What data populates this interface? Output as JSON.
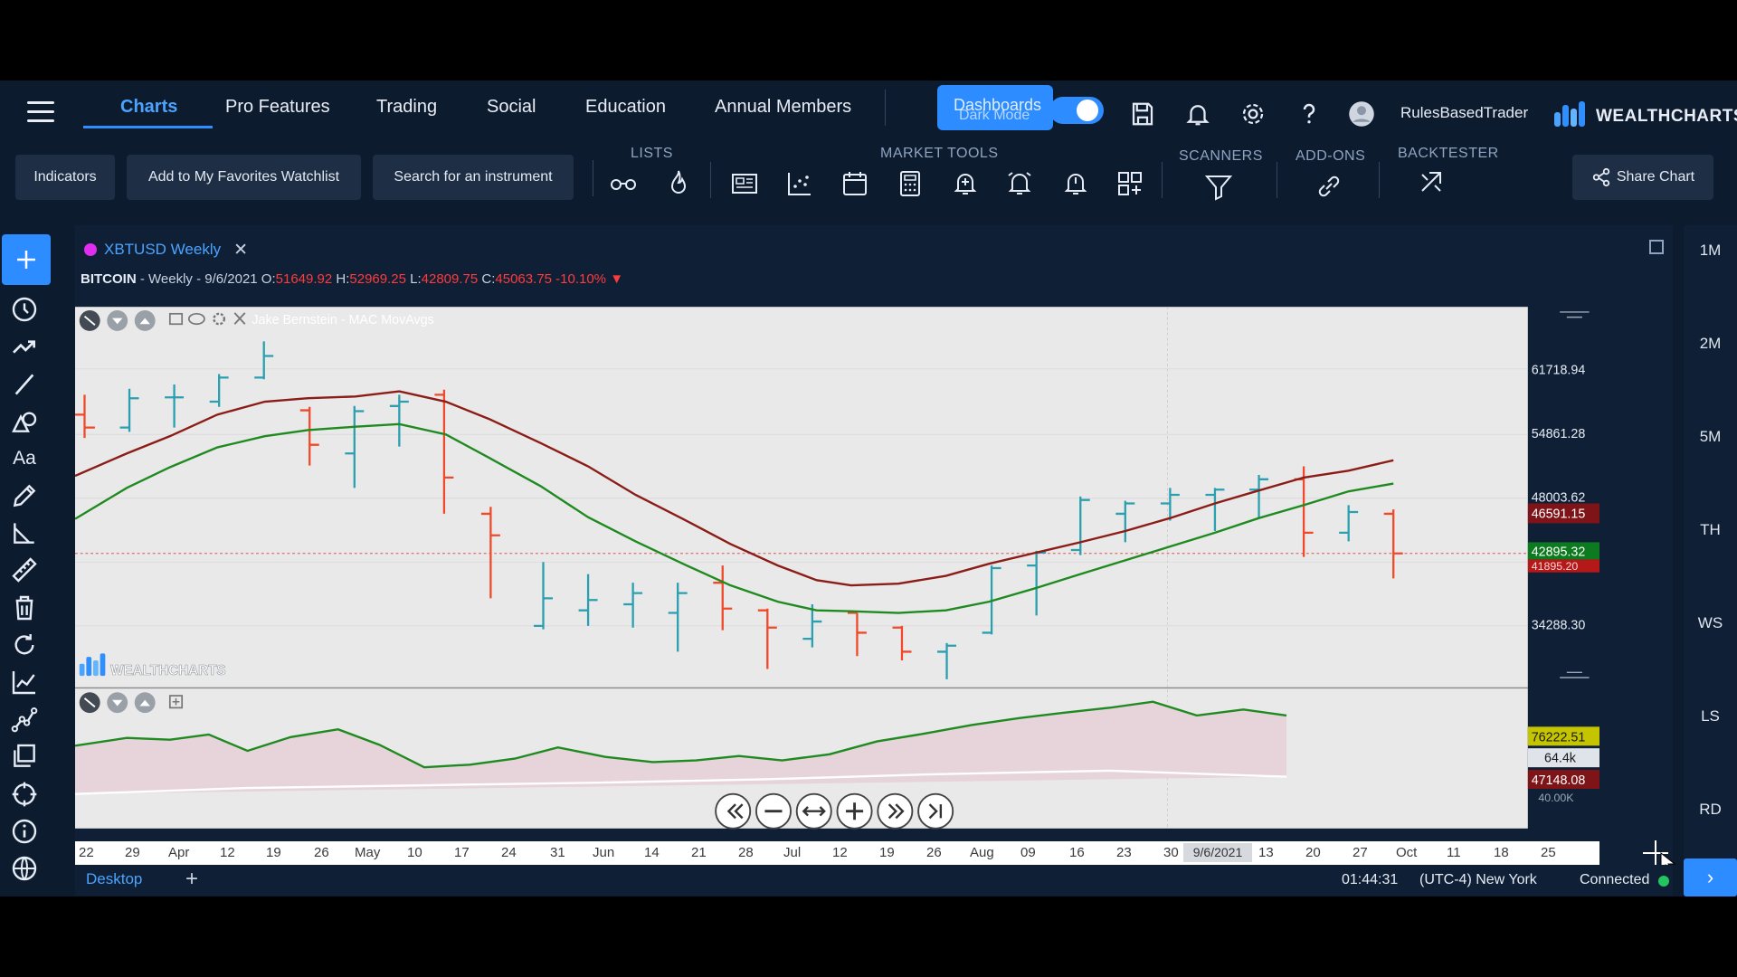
{
  "nav": {
    "tabs": [
      {
        "label": "Charts"
      },
      {
        "label": "Pro Features"
      },
      {
        "label": "Trading"
      },
      {
        "label": "Social"
      },
      {
        "label": "Education"
      },
      {
        "label": "Annual Members"
      }
    ],
    "dashboards_label": "Dashboards",
    "dark_mode_label": "Dark Mode",
    "dark_mode_on": true,
    "username": "RulesBasedTrader",
    "brand": "WEALTHCHARTS"
  },
  "toolbar": {
    "indicators_label": "Indicators",
    "favorites_label": "Add to My Favorites Watchlist",
    "search_label": "Search for an instrument",
    "lists_label": "LISTS",
    "market_tools_label": "MARKET TOOLS",
    "scanners_label": "SCANNERS",
    "addons_label": "ADD-ONS",
    "backtester_label": "BACKTESTER",
    "share_label": "Share Chart"
  },
  "chart": {
    "tab_label": "XBTUSD Weekly",
    "info": {
      "symbol": "BITCOIN",
      "meta": " - Weekly - 9/6/2021 ",
      "o_label": "O:",
      "o_val": "51649.92",
      "h_label": " H:",
      "h_val": "52969.25",
      "l_label": " L:",
      "l_val": "42809.75",
      "c_label": " C:",
      "c_val": "45063.75",
      "change": " -10.10%"
    },
    "indicator_name": "Jake Bernstein - MAC MovAvgs",
    "watermark": "WEALTHCHARTS",
    "price_ticks": [
      "61718.94",
      "54861.28",
      "48003.62",
      "34288.30"
    ],
    "price_labels": {
      "red": "46591.15",
      "green": "42895.32",
      "under": "41895.20"
    },
    "lower_labels": {
      "top": "76222.51",
      "mid": "64.4k",
      "low": "47148.08",
      "tick": "40.00K"
    },
    "x_ticks": [
      "22",
      "29",
      "Apr",
      "12",
      "19",
      "26",
      "May",
      "10",
      "17",
      "24",
      "31",
      "Jun",
      "14",
      "21",
      "28",
      "Jul",
      "12",
      "19",
      "26",
      "Aug",
      "09",
      "16",
      "23",
      "30",
      "13",
      "20",
      "27",
      "Oct",
      "11",
      "18",
      "25"
    ],
    "x_selected": "9/6/2021",
    "colors": {
      "red_ma": "#8b1c16",
      "green_ma": "#1f8a1f",
      "bull": "#2a9faf",
      "bear": "#f04828"
    }
  },
  "right_sidebar": {
    "items": [
      "1M",
      "2M",
      "5M",
      "TH",
      "WS",
      "LS",
      "RD"
    ]
  },
  "bottom": {
    "desktop_label": "Desktop",
    "time": "01:44:31",
    "timezone": "(UTC-4) New York",
    "status": "Connected"
  }
}
